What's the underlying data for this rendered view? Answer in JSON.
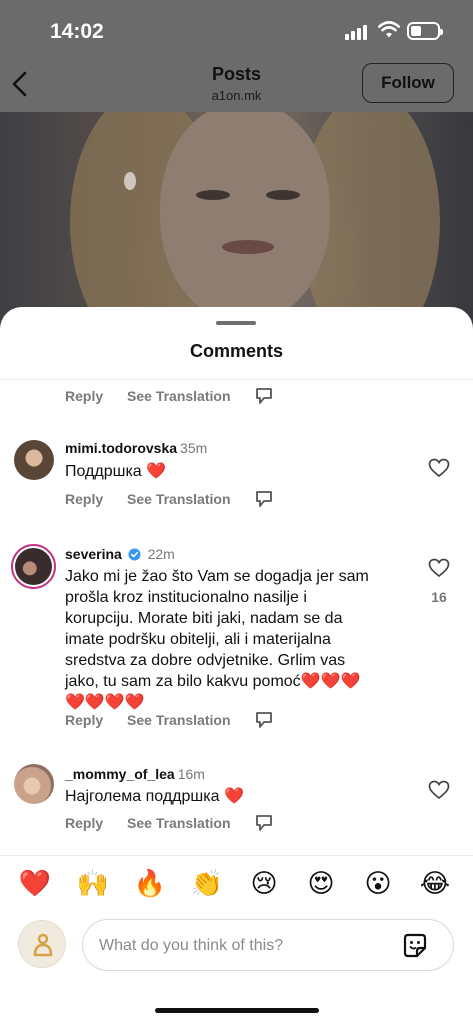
{
  "status_bar": {
    "time": "14:02"
  },
  "nav": {
    "title": "Posts",
    "subtitle": "a1on.mk",
    "follow_label": "Follow"
  },
  "sheet": {
    "title": "Comments"
  },
  "actions": {
    "reply": "Reply",
    "see_translation": "See Translation"
  },
  "comments": [
    {
      "username": "mimi.todorovska",
      "ago": "35m",
      "text": "Поддршка",
      "trailing": "❤️",
      "likes": ""
    },
    {
      "username": "severina",
      "verified": true,
      "ago": "22m",
      "lines": [
        "Jako mi je žao što Vam se dogadja jer  sam",
        "prošla kroz institucionalno nasilje i",
        "korupciju. Morate biti jaki, nadam se da",
        "imate podršku obitelji, ali i materijalna",
        "sredstva za dobre odvjetnike. Grlim vas",
        "jako, tu sam za bilo kakvu pomoć❤️❤️❤️",
        "❤️❤️❤️❤️"
      ],
      "likes": "16"
    },
    {
      "username": "_mommy_of_lea",
      "ago": "16m",
      "text": "Најголема поддршка",
      "trailing": "❤️",
      "likes": ""
    }
  ],
  "emoji_bar": [
    "❤️",
    "🙌",
    "🔥",
    "👏",
    "😢",
    "😍",
    "😮",
    "😂"
  ],
  "composer": {
    "placeholder": "What do you think of this?"
  },
  "colors": {
    "like_red": "#e0262d",
    "verified_blue": "#3897f0"
  },
  "icons": [
    "back-arrow-icon",
    "signal-icon",
    "wifi-icon",
    "battery-icon",
    "heart-outline-icon",
    "reaction-bubble-icon",
    "verified-badge-icon",
    "sticker-icon"
  ]
}
